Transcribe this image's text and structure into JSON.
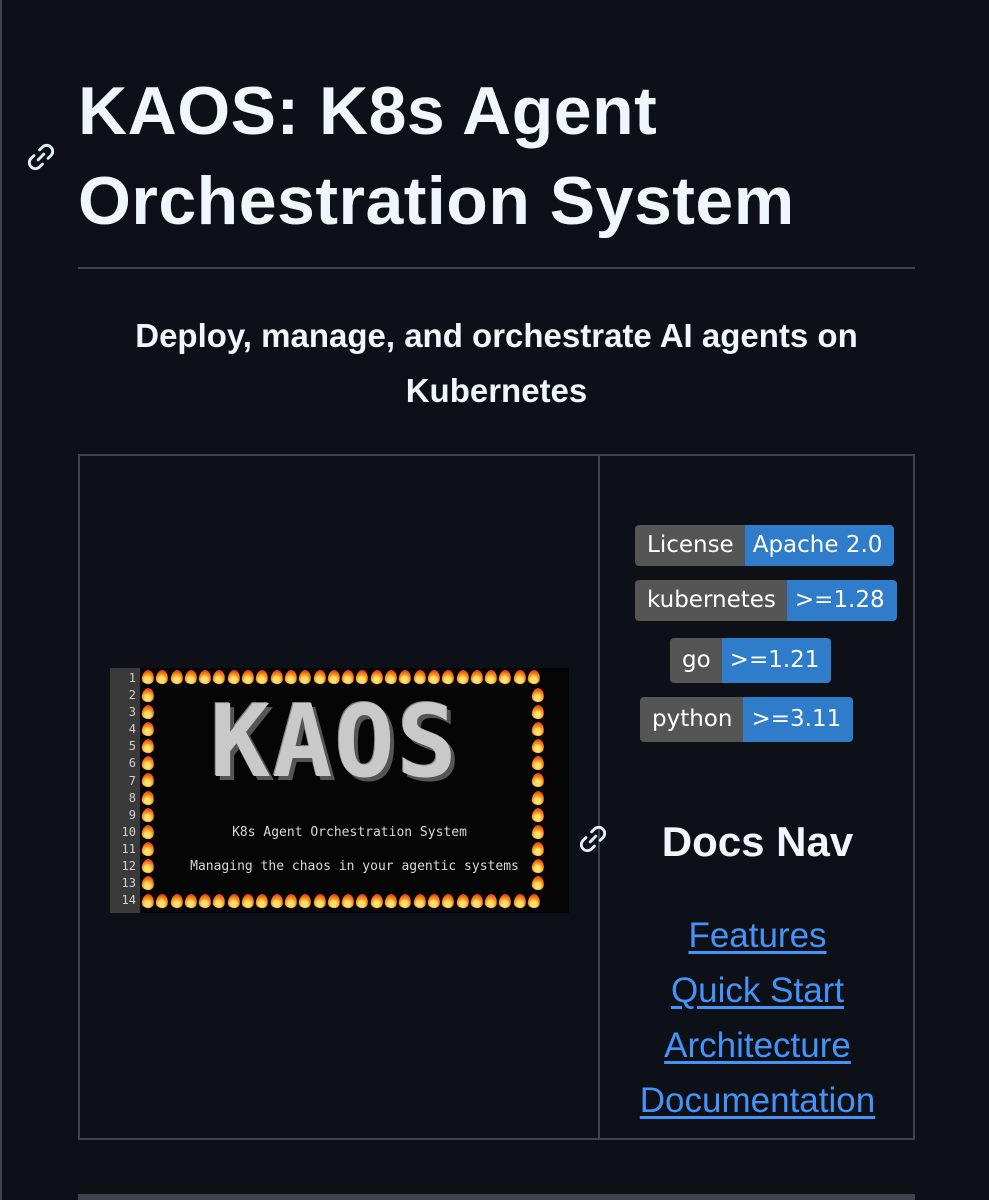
{
  "header": {
    "title": "KAOS: K8s Agent Orchestration System",
    "tagline": "Deploy, manage, and orchestrate AI agents on Kubernetes"
  },
  "banner": {
    "logo_text": "KAOS",
    "subtitle": "K8s Agent Orchestration System",
    "slogan": "Managing the chaos in your agentic systems",
    "line_numbers": [
      "1",
      "2",
      "3",
      "4",
      "5",
      "6",
      "7",
      "8",
      "9",
      "10",
      "11",
      "12",
      "13",
      "14"
    ]
  },
  "badges": [
    {
      "label": "License",
      "value": "Apache 2.0"
    },
    {
      "label": "kubernetes",
      "value": ">=1.28"
    },
    {
      "label": "go",
      "value": ">=1.21"
    },
    {
      "label": "python",
      "value": ">=3.11"
    }
  ],
  "docs_nav": {
    "title": "Docs Nav",
    "links": [
      "Features",
      "Quick Start",
      "Architecture",
      "Documentation"
    ]
  },
  "colors": {
    "background": "#0d1117",
    "link": "#4493f8",
    "badge_label": "#555555",
    "badge_value": "#2f7ccb",
    "border": "#3d444d"
  },
  "icons": {
    "heading_anchor": "link-icon",
    "section_anchor": "link-icon",
    "flames": "fire-icon"
  }
}
